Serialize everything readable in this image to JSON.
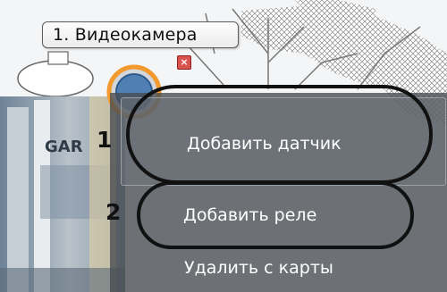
{
  "camera_tooltip": {
    "label": "1. Видеокамера"
  },
  "close_glyph": "×",
  "context_menu": {
    "items": [
      {
        "label": "Добавить датчик"
      },
      {
        "label": "Добавить реле"
      },
      {
        "label": "Удалить с карты"
      }
    ]
  },
  "annotations": [
    "1",
    "2"
  ],
  "colors": {
    "menu_background": "#464a50",
    "menu_text": "#ffffff",
    "highlight_ring": "#f29a2e",
    "annotation_stroke": "#111111"
  }
}
